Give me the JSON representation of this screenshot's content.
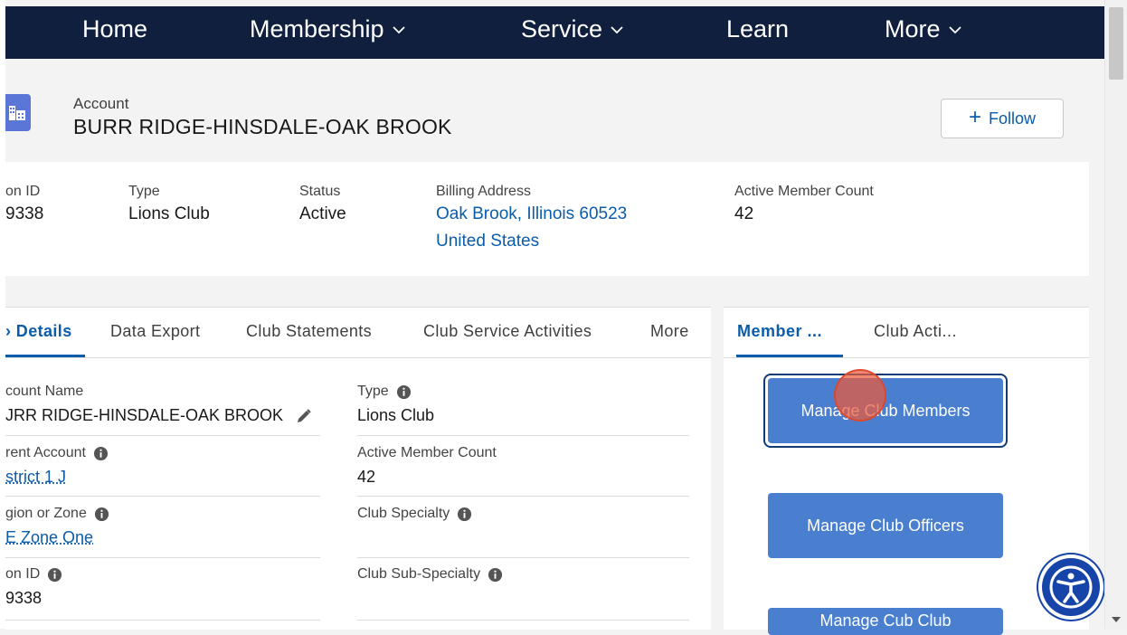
{
  "nav": {
    "home": "Home",
    "membership": "Membership",
    "service": "Service",
    "learn": "Learn",
    "more": "More"
  },
  "header": {
    "object_label": "Account",
    "record_name": "BURR RIDGE-HINSDALE-OAK BROOK",
    "follow_label": "Follow"
  },
  "highlights": {
    "id_label": "on ID",
    "id_value": "9338",
    "type_label": "Type",
    "type_value": "Lions Club",
    "status_label": "Status",
    "status_value": "Active",
    "billing_label": "Billing Address",
    "billing_line1": "Oak Brook, Illinois 60523",
    "billing_line2": "United States",
    "members_label": "Active Member Count",
    "members_value": "42"
  },
  "detail_tabs": [
    {
      "label": "› Details"
    },
    {
      "label": "Data Export"
    },
    {
      "label": "Club Statements"
    },
    {
      "label": "Club Service Activities"
    },
    {
      "label": "More"
    }
  ],
  "fields": {
    "account_name_label": "count Name",
    "account_name_value": "JRR RIDGE-HINSDALE-OAK BROOK",
    "type_label": "Type",
    "type_value": "Lions Club",
    "parent_label": "rent Account",
    "parent_value": "strict 1 J",
    "active_count_label": "Active Member Count",
    "active_count_value": "42",
    "region_label": "gion or Zone",
    "region_value": "E Zone One",
    "specialty_label": "Club Specialty",
    "id_label": "on ID",
    "id_value": "9338",
    "subspecialty_label": "Club Sub-Specialty"
  },
  "side_tabs": [
    {
      "label": "Member ..."
    },
    {
      "label": "Club Acti..."
    }
  ],
  "actions": {
    "manage_members": "Manage Club Members",
    "manage_officers": "Manage Club Officers",
    "manage_cub": "Manage Cub Club"
  },
  "colors": {
    "nav_bg": "#0f1f3d",
    "brand_blue": "#0b5cab",
    "action_blue": "#4a7fd0"
  }
}
